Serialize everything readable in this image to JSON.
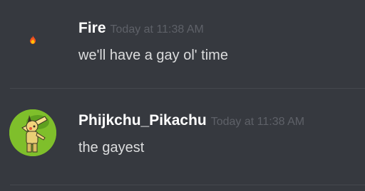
{
  "messages": [
    {
      "username": "Fire",
      "timestamp": "Today at 11:38 AM",
      "content": "we'll have a gay ol' time",
      "avatar": "fire-emoji-avatar"
    },
    {
      "username": "Phijkchu_Pikachu",
      "timestamp": "Today at 11:38 AM",
      "content": "the gayest",
      "avatar": "dabbing-pikachu-avatar"
    }
  ],
  "colors": {
    "background": "#36393f",
    "username": "#ffffff",
    "timestamp": "#5e6168",
    "content": "#dcddde",
    "divider": "#45484e",
    "avatar_green": "#7fbf2b"
  }
}
